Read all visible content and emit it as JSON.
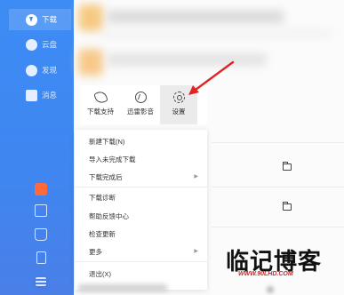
{
  "sidebar": {
    "items": [
      {
        "label": "下载",
        "icon": "download-icon",
        "active": true
      },
      {
        "label": "云盘",
        "icon": "cloud-icon",
        "active": false
      },
      {
        "label": "发现",
        "icon": "compass-icon",
        "active": false
      },
      {
        "label": "消息",
        "icon": "message-icon",
        "active": false
      }
    ],
    "bottom_icons": [
      "gift-icon",
      "gamepad-icon",
      "shirt-icon",
      "phone-icon",
      "menu-icon"
    ]
  },
  "toolbar": {
    "download_support": "下载支持",
    "thunder_video": "迅雷影音",
    "settings": "设置"
  },
  "menu": {
    "new_download": "新建下载(N)",
    "import_unfinished": "导入未完成下载",
    "after_download": "下载完成后",
    "download_diagnosis": "下载诊断",
    "help_feedback": "帮助反馈中心",
    "check_update": "检查更新",
    "more": "更多",
    "exit": "退出(X)"
  },
  "watermark": {
    "title": "临记博客",
    "url": "WWW.90LHD.COM"
  },
  "colors": {
    "sidebar": "#3d8cf5",
    "arrow": "#e02424",
    "accent_gift": "#ff6a3d"
  }
}
